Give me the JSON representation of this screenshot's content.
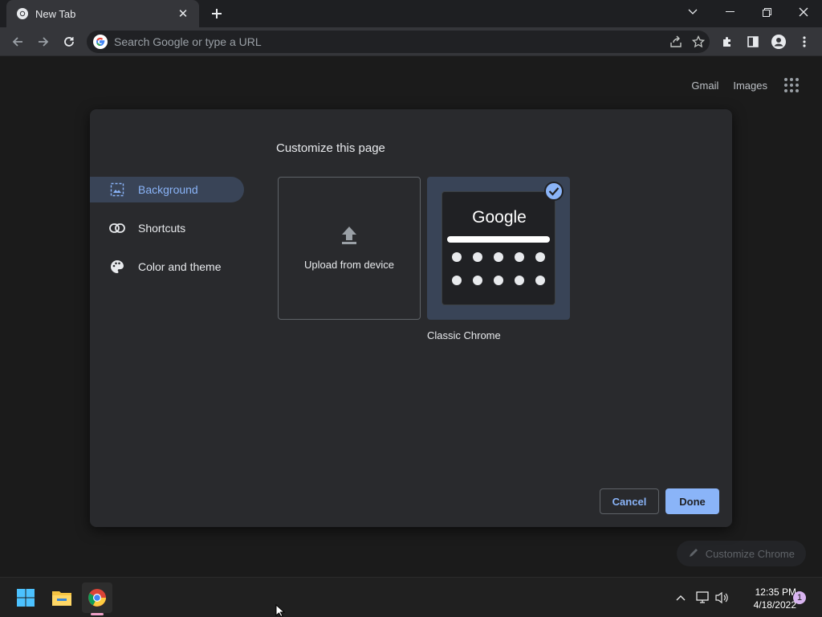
{
  "browser": {
    "tab_title": "New Tab",
    "omnibox_placeholder": "Search Google or type a URL"
  },
  "page": {
    "top_links": {
      "gmail": "Gmail",
      "images": "Images"
    },
    "customize_chrome_label": "Customize Chrome"
  },
  "dialog": {
    "title": "Customize this page",
    "sidebar": [
      {
        "label": "Background",
        "icon": "image-icon",
        "active": true
      },
      {
        "label": "Shortcuts",
        "icon": "link-icon",
        "active": false
      },
      {
        "label": "Color and theme",
        "icon": "palette-icon",
        "active": false
      }
    ],
    "tiles": {
      "upload_label": "Upload from device",
      "classic_label": "Classic Chrome",
      "classic_preview_logo": "Google",
      "classic_selected": true
    },
    "buttons": {
      "cancel": "Cancel",
      "done": "Done"
    }
  },
  "taskbar": {
    "apps": [
      "windows-start-icon",
      "file-explorer-icon",
      "chrome-icon"
    ],
    "active_app": "chrome-icon",
    "time": "12:35 PM",
    "date": "4/18/2022",
    "notification_count": "1"
  },
  "colors": {
    "accent": "#8ab4f8",
    "dialog_bg": "#292a2d",
    "selected_tile": "#394457",
    "page_bg": "#1b1b1b"
  }
}
